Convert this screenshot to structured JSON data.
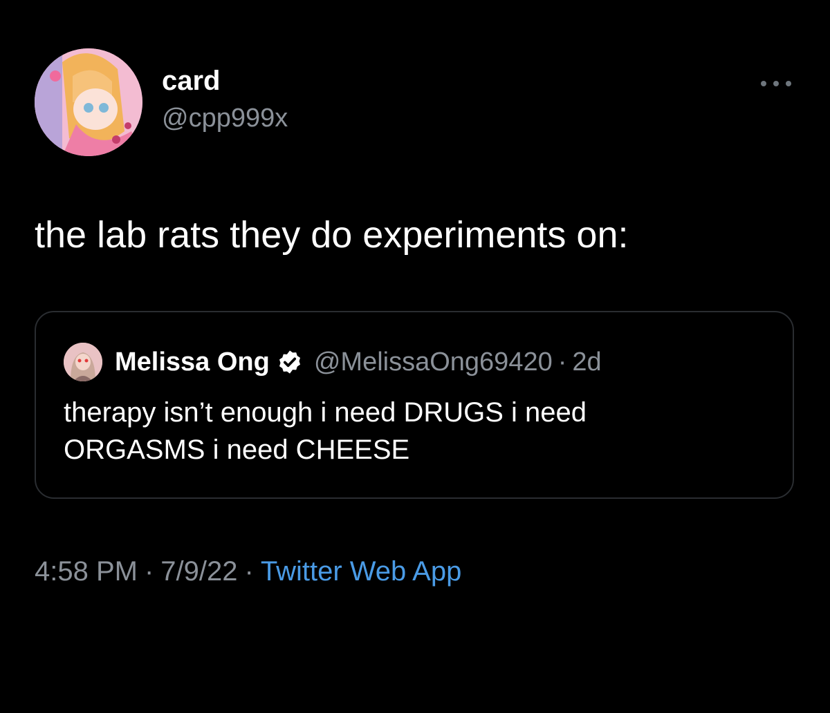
{
  "tweet": {
    "author": {
      "display_name": "card",
      "handle": "@cpp999x",
      "avatar_icon": "anime-girl-avatar"
    },
    "more_icon": "more-horizontal-icon",
    "text": "the lab rats they do experiments on:",
    "quoted_tweet": {
      "author": {
        "display_name": "Melissa Ong",
        "handle": "@MelissaOng69420",
        "verified_icon": "verified-badge-icon",
        "avatar_icon": "user-avatar"
      },
      "separator": "·",
      "time_ago": "2d",
      "text_line_1": "therapy isn’t enough i need DRUGS i need",
      "text_line_2": "ORGASMS i need CHEESE"
    },
    "meta": {
      "time": "4:58 PM",
      "separator": "·",
      "date": "7/9/22",
      "source": "Twitter Web App"
    }
  },
  "colors": {
    "background": "#000000",
    "text_primary": "#ffffff",
    "text_secondary": "#8b9199",
    "link": "#4a9be6",
    "border": "#2a2d31"
  }
}
